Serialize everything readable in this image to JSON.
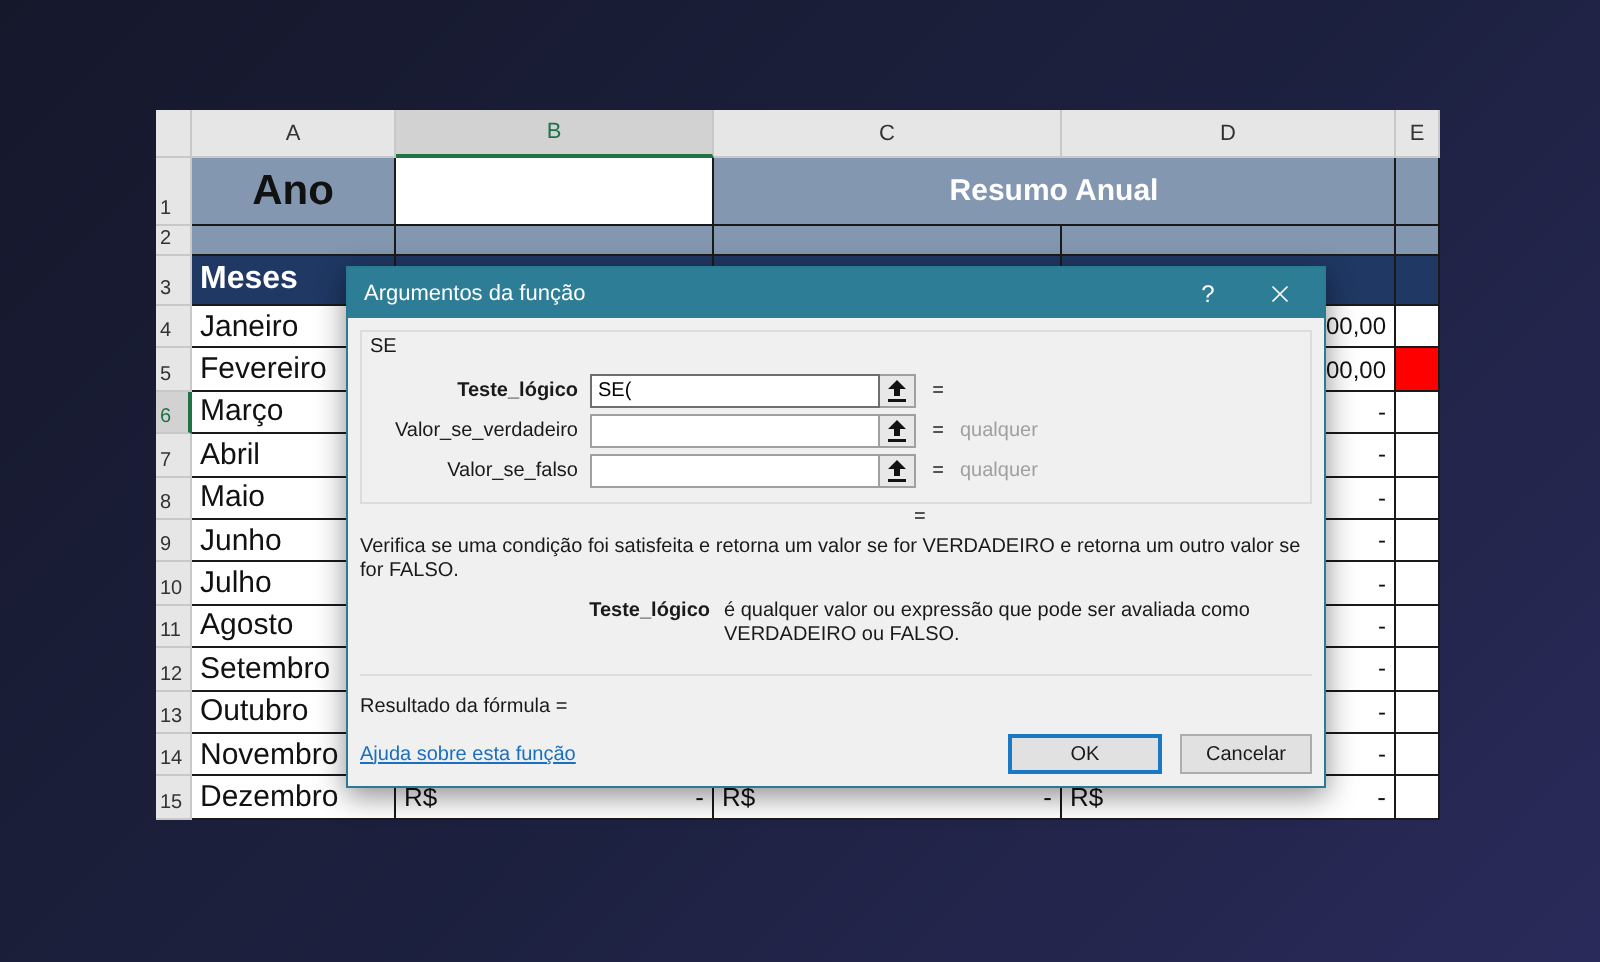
{
  "sheet": {
    "columns": [
      {
        "label": "A",
        "selected": false
      },
      {
        "label": "B",
        "selected": true
      },
      {
        "label": "C",
        "selected": false
      },
      {
        "label": "D",
        "selected": false
      },
      {
        "label": "E",
        "selected": false
      }
    ],
    "rows": [
      {
        "number": "1",
        "selected": false,
        "kind": "title",
        "year_label": "Ano",
        "summary_title": "Resumo Anual"
      },
      {
        "number": "2",
        "selected": false,
        "kind": "spacer"
      },
      {
        "number": "3",
        "selected": false,
        "kind": "header",
        "label": "Meses"
      },
      {
        "number": "4",
        "selected": false,
        "kind": "month",
        "month": "Janeiro",
        "d": {
          "value": "00,00"
        }
      },
      {
        "number": "5",
        "selected": false,
        "kind": "month",
        "month": "Fevereiro",
        "d": {
          "value": "00,00"
        },
        "e": {
          "color": "#ff0000"
        }
      },
      {
        "number": "6",
        "selected": true,
        "kind": "month",
        "month": "Março",
        "d": {
          "value": "-"
        }
      },
      {
        "number": "7",
        "selected": false,
        "kind": "month",
        "month": "Abril",
        "d": {
          "value": "-"
        }
      },
      {
        "number": "8",
        "selected": false,
        "kind": "month",
        "month": "Maio",
        "d": {
          "value": "-"
        }
      },
      {
        "number": "9",
        "selected": false,
        "kind": "month",
        "month": "Junho",
        "d": {
          "value": "-"
        }
      },
      {
        "number": "10",
        "selected": false,
        "kind": "month",
        "month": "Julho",
        "d": {
          "value": "-"
        }
      },
      {
        "number": "11",
        "selected": false,
        "kind": "month",
        "month": "Agosto",
        "d": {
          "value": "-"
        }
      },
      {
        "number": "12",
        "selected": false,
        "kind": "month",
        "month": "Setembro",
        "d": {
          "value": "-"
        }
      },
      {
        "number": "13",
        "selected": false,
        "kind": "month",
        "month": "Outubro",
        "d": {
          "value": "-"
        }
      },
      {
        "number": "14",
        "selected": false,
        "kind": "month",
        "month": "Novembro",
        "d": {
          "value": "-"
        }
      },
      {
        "number": "15",
        "selected": false,
        "kind": "month",
        "month": "Dezembro",
        "b": {
          "currency": "R$",
          "value": "-"
        },
        "c": {
          "currency": "R$",
          "value": "-"
        },
        "d": {
          "currency": "R$",
          "value": "-"
        }
      }
    ]
  },
  "dialog": {
    "title": "Argumentos da função",
    "help": "?",
    "function_name": "SE",
    "arguments": [
      {
        "label": "Teste_lógico",
        "value": "SE(",
        "selected": true,
        "equals": "="
      },
      {
        "label": "Valor_se_verdadeiro",
        "selected": false,
        "equals": "=",
        "result": "qualquer"
      },
      {
        "label": "Valor_se_falso",
        "selected": false,
        "equals": "=",
        "result": "qualquer"
      }
    ],
    "formula_equals": "=",
    "description": "Verifica se uma condição foi satisfeita e retorna um valor se for VERDADEIRO e retorna um outro valor se for FALSO.",
    "argument_help": {
      "name": "Teste_lógico",
      "text": "é qualquer valor ou expressão que pode ser avaliada como VERDADEIRO ou FALSO."
    },
    "result_label": "Resultado da fórmula =",
    "help_link": "Ajuda sobre esta função",
    "buttons": [
      {
        "label": "OK",
        "default": true
      },
      {
        "label": "Cancelar",
        "default": false
      }
    ]
  }
}
